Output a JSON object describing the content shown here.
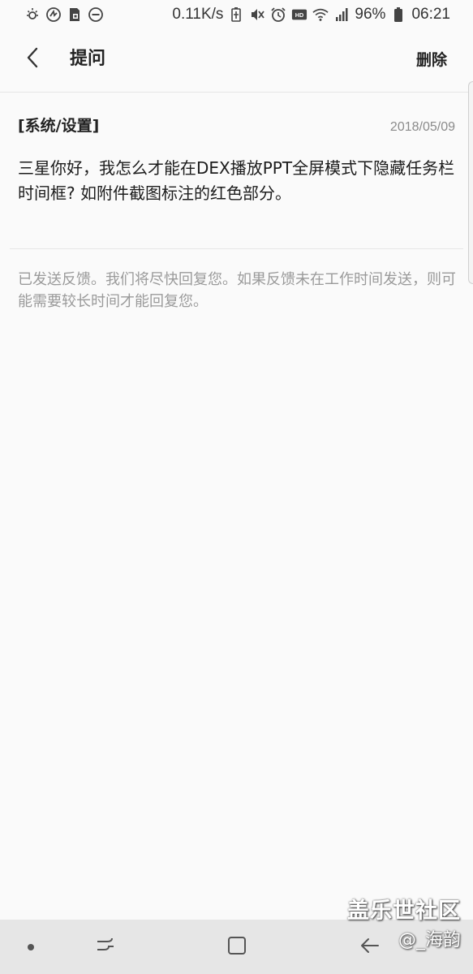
{
  "status_bar": {
    "left_icons": [
      "sun-icon",
      "spark-icon",
      "sd-lock-icon",
      "dnd-icon"
    ],
    "network_speed": "0.11K/s",
    "right_icons": [
      "battery-saver-icon",
      "mute-icon",
      "alarm-icon",
      "hd-icon",
      "wifi-icon",
      "signal-icon",
      "battery-icon"
    ],
    "battery_percent": "96%",
    "time": "06:21"
  },
  "app_bar": {
    "title": "提问",
    "delete_label": "删除"
  },
  "question": {
    "category": "[系统/设置]",
    "date": "2018/05/09",
    "body": "三星你好，我怎么才能在DEX播放PPT全屏模式下隐藏任务栏时间框? 如附件截图标注的红色部分。"
  },
  "feedback_note": "已发送反馈。我们将尽快回复您。如果反馈未在工作时间发送，则可能需要较长时间才能回复您。",
  "watermark": {
    "site": "盖乐世社区",
    "author": "@_海韵"
  },
  "nav_bar": {
    "icons": [
      "dot-icon",
      "recent-apps-icon",
      "home-icon",
      "back-arrow-icon"
    ]
  },
  "colors": {
    "background": "#fafafa",
    "nav_background": "#e6e6e6",
    "text_primary": "#222222",
    "text_secondary": "#9a9a9a"
  }
}
